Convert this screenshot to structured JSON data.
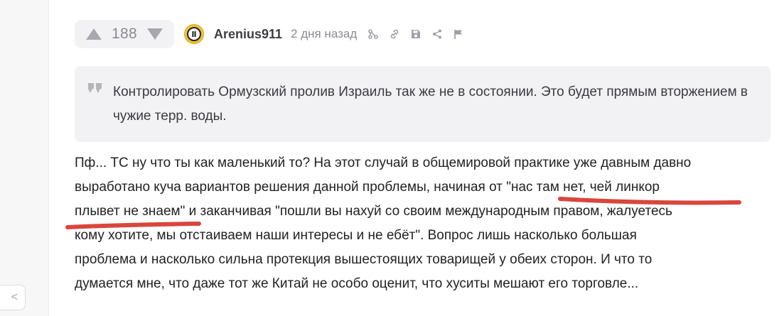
{
  "sidebar": {
    "collapse_icon": "chevron-left-icon",
    "collapse_label": "<"
  },
  "comment": {
    "rating": "188",
    "author": "Arenius911",
    "time": "2 дня назад",
    "actions": [
      "branch-icon",
      "link-icon",
      "save-icon",
      "share-icon",
      "report-flag-icon"
    ],
    "quote": "Контролировать Ормузский пролив Израиль так же не в состоянии. Это будет прямым вторжением в чужие терр. воды.",
    "body_lines": [
      "Пф... ТС ну что ты как маленький то? На этот случай в общемировой практике уже давным давно",
      "выработано куча вариантов решения данной проблемы, начиная от \"нас там нет, чей линкор",
      "плывет не знаем\" и заканчивая \"пошли вы нахуй со своим международным правом, жалуетесь",
      "кому хотите, мы отстаиваем наши интересы и не ебёт\". Вопрос лишь насколько большая",
      "проблема и насколько сильна протекция вышестоящих товарищей у обеих сторон. И что то",
      "думается мне, что даже тот же Китай не особо оценит, что хуситы мешают его торговле..."
    ]
  },
  "colors": {
    "accent_underline": "#d9463d",
    "muted": "#8b8b92",
    "panel": "#f2f2f4",
    "avatar_bg": "#f1c232"
  }
}
